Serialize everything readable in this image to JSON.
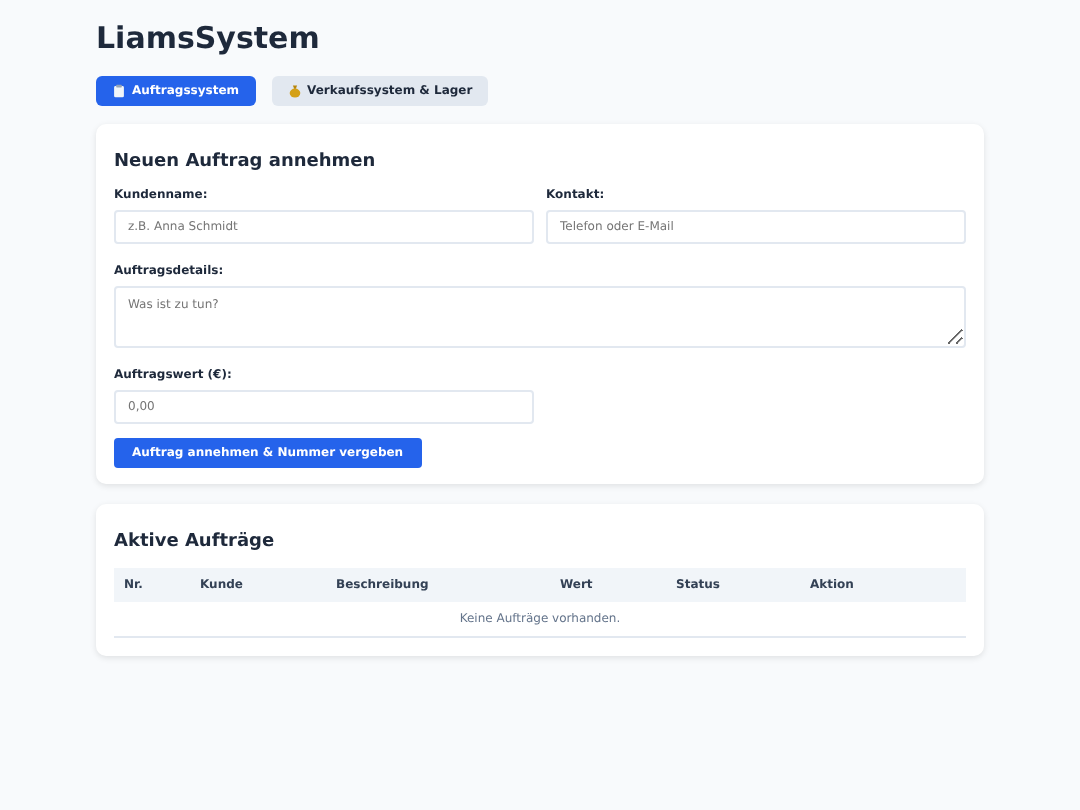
{
  "app_title": "LiamsSystem",
  "tabs": [
    {
      "label": "Auftragssystem",
      "selected": true
    },
    {
      "label": "Verkaufssystem & Lager",
      "selected": false
    }
  ],
  "order_form": {
    "title": "Neuen Auftrag annehmen",
    "fields": [
      {
        "label": "Kundenname:",
        "placeholder": "z.B. Anna Schmidt",
        "kind": "input"
      },
      {
        "label": "Kontakt:",
        "placeholder": "Telefon oder E-Mail",
        "kind": "input"
      },
      {
        "label": "Auftragsdetails:",
        "placeholder": "Was ist zu tun?",
        "kind": "textarea"
      },
      {
        "label": "Auftragswert (€):",
        "placeholder": "0,00",
        "kind": "input"
      }
    ],
    "submit": "Auftrag annehmen & Nummer vergeben"
  },
  "orders": {
    "title": "Aktive Aufträge",
    "columns": [
      "Nr.",
      "Kunde",
      "Beschreibung",
      "Wert",
      "Status",
      "Aktion"
    ],
    "empty_message": "Keine Aufträge vorhanden."
  }
}
